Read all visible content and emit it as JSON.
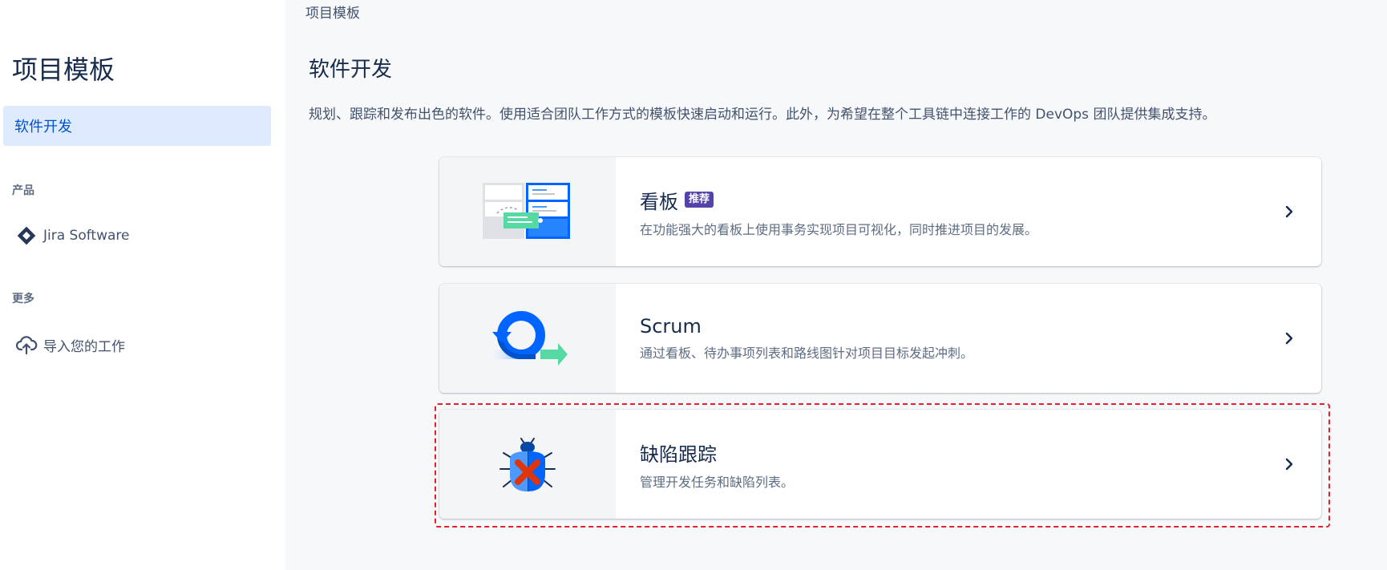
{
  "sidebar": {
    "title": "项目模板",
    "selected_item": "软件开发",
    "sections": [
      {
        "label": "产品",
        "items": [
          {
            "label": "Jira Software",
            "icon": "jira-diamond-icon"
          }
        ]
      },
      {
        "label": "更多",
        "items": [
          {
            "label": "导入您的工作",
            "icon": "cloud-upload-icon"
          }
        ]
      }
    ]
  },
  "main": {
    "breadcrumb": "项目模板",
    "title": "软件开发",
    "description": "规划、跟踪和发布出色的软件。使用适合团队工作方式的模板快速启动和运行。此外，为希望在整个工具链中连接工作的 DevOps 团队提供集成支持。",
    "templates": [
      {
        "title": "看板",
        "badge": "推荐",
        "description": "在功能强大的看板上使用事务实现项目可视化，同时推进项目的发展。",
        "illustration": "kanban-board-illustration"
      },
      {
        "title": "Scrum",
        "badge": "",
        "description": "通过看板、待办事项列表和路线图针对项目目标发起冲刺。",
        "illustration": "scrum-cycle-illustration"
      },
      {
        "title": "缺陷跟踪",
        "badge": "",
        "description": "管理开发任务和缺陷列表。",
        "illustration": "bug-tracking-illustration"
      }
    ]
  },
  "colors": {
    "accent": "#0052cc",
    "selected_bg": "#deebff",
    "badge_bg": "#5243aa",
    "highlight_border": "#e5202e"
  }
}
